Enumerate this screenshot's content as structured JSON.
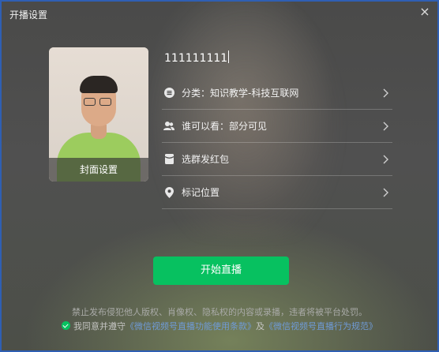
{
  "window": {
    "title": "开播设置",
    "close_glyph": "×"
  },
  "cover": {
    "label": "封面设置"
  },
  "title_input": {
    "value": "111111111"
  },
  "menu": {
    "category": {
      "icon": "list-circle-icon",
      "label": "分类：知识教学-科技互联网"
    },
    "visibility": {
      "icon": "users-icon",
      "label": "谁可以看：部分可见"
    },
    "red_packet": {
      "icon": "red-packet-icon",
      "label": "选群发红包"
    },
    "location": {
      "icon": "location-pin-icon",
      "label": "标记位置"
    }
  },
  "start_button": {
    "label": "开始直播"
  },
  "footer": {
    "notice": "禁止发布侵犯他人版权、肖像权、隐私权的内容或录播，违者将被平台处罚。",
    "agree_prefix": "我同意并遵守",
    "link1": "《微信视频号直播功能使用条款》",
    "and": "及",
    "link2": "《微信视频号直播行为规范》"
  },
  "colors": {
    "accent": "#07c160",
    "link": "#6f9bd8",
    "frame": "#2f5fb3"
  }
}
